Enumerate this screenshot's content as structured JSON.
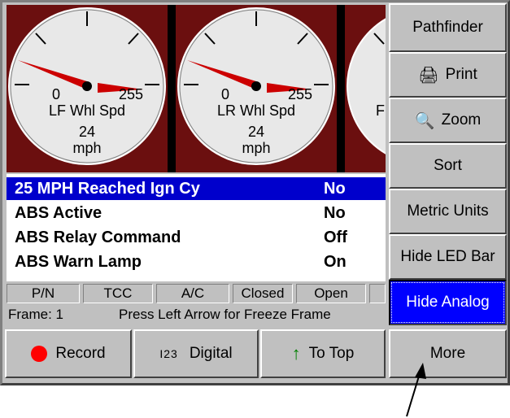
{
  "gauges": [
    {
      "label": "LF Whl Spd",
      "value": "24",
      "unit": "mph",
      "min": "0",
      "max": "255"
    },
    {
      "label": "LR Whl Spd",
      "value": "24",
      "unit": "mph",
      "min": "0",
      "max": "255"
    }
  ],
  "gauge3_partial": {
    "min": "(",
    "label": "F"
  },
  "sidebar": {
    "pathfinder": "Pathfinder",
    "print": "Print",
    "zoom": "Zoom",
    "sort": "Sort",
    "metric": "Metric Units",
    "hide_led": "Hide LED Bar",
    "hide_analog": "Hide Analog"
  },
  "params": [
    {
      "name": "25 MPH Reached Ign Cy",
      "value": "No",
      "selected": true
    },
    {
      "name": "ABS Active",
      "value": "No"
    },
    {
      "name": "ABS Relay Command",
      "value": "Off"
    },
    {
      "name": "ABS Warn Lamp",
      "value": "On"
    }
  ],
  "led_bar": [
    "P/N",
    "TCC",
    "A/C",
    "Closed",
    "Open"
  ],
  "status": {
    "frame": "Frame: 1",
    "message": "Press Left Arrow for Freeze Frame"
  },
  "bottom": {
    "record": "Record",
    "digital_icon": "I23",
    "digital": "Digital",
    "to_top": "To Top",
    "more": "More"
  },
  "colors": {
    "gauge_bg": "#6b0f0f",
    "needle": "#cc0000",
    "selection": "#0000cc",
    "active_button": "#0000ff",
    "record_dot": "#ff0000",
    "to_top_arrow": "#008000"
  }
}
